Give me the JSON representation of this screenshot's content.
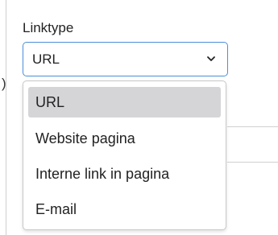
{
  "field": {
    "label": "Linktype",
    "selected_value": "URL"
  },
  "dropdown": {
    "options": [
      {
        "label": "URL",
        "selected": true
      },
      {
        "label": "Website pagina",
        "selected": false
      },
      {
        "label": "Interne link in pagina",
        "selected": false
      },
      {
        "label": "E-mail",
        "selected": false
      }
    ]
  },
  "icons": {
    "select_arrow": "chevron-down-icon"
  },
  "colors": {
    "focus_border": "#4a8fd8",
    "selected_option_bg": "#d5d5d8"
  }
}
